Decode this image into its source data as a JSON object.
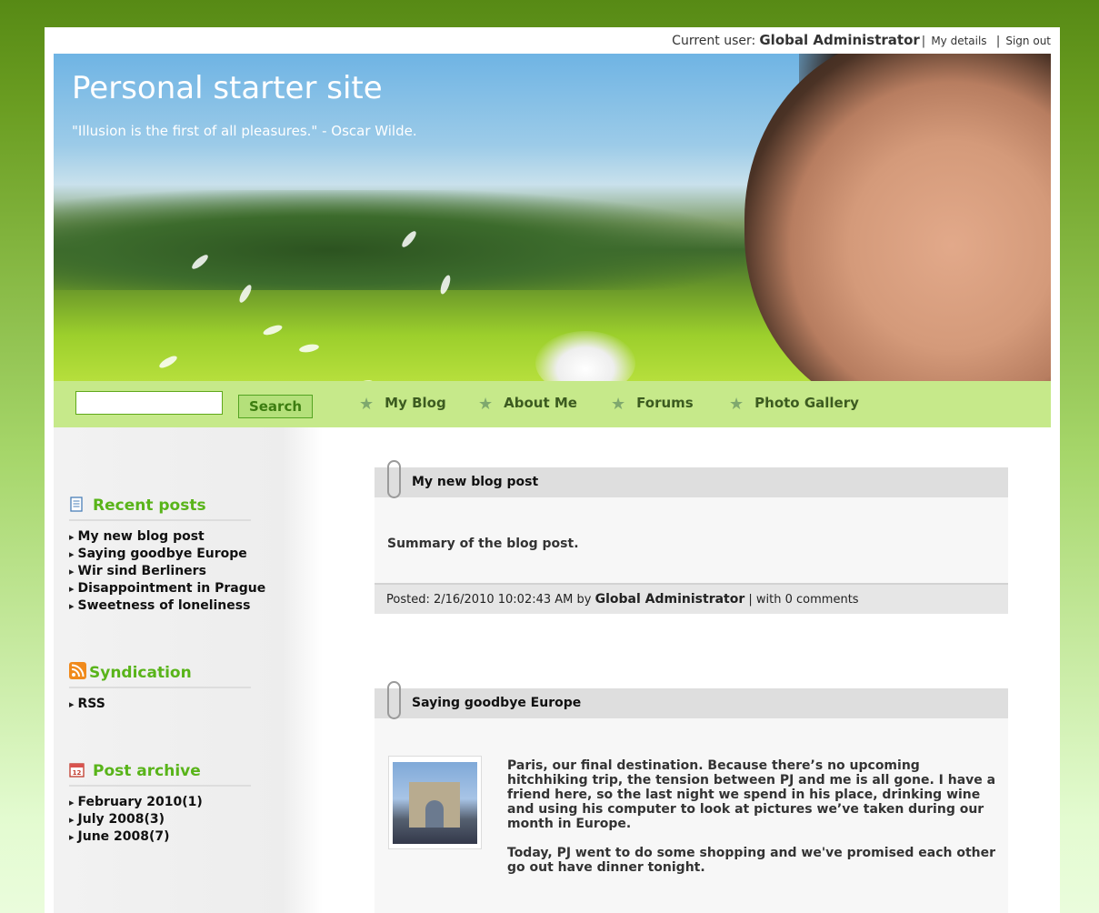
{
  "topbar": {
    "current_user_label": "Current user:",
    "user_name": "Global Administrator",
    "my_details": "My details",
    "sign_out": "Sign out"
  },
  "header": {
    "title": "Personal starter site",
    "quote": "\"Illusion is the first of all pleasures.\" - Oscar Wilde."
  },
  "search": {
    "value": "",
    "button_label": "Search"
  },
  "nav": {
    "items": [
      {
        "label": "My Blog",
        "icon": "star-icon"
      },
      {
        "label": "About Me",
        "icon": "star-icon"
      },
      {
        "label": "Forums",
        "icon": "star-icon"
      },
      {
        "label": "Photo Gallery",
        "icon": "star-icon"
      }
    ]
  },
  "sidebar": {
    "recent_posts": {
      "title": "Recent posts",
      "icon": "document-icon",
      "items": [
        "My new blog post",
        "Saying goodbye Europe",
        "Wir sind Berliners",
        "Disappointment in Prague",
        "Sweetness of loneliness"
      ]
    },
    "syndication": {
      "title": "Syndication",
      "icon": "rss-icon",
      "items": [
        "RSS"
      ]
    },
    "archive": {
      "title": "Post archive",
      "icon": "calendar-icon",
      "items": [
        "February 2010(1)",
        "July 2008(3)",
        "June 2008(7)"
      ]
    }
  },
  "posts": [
    {
      "title": "My new blog post",
      "summary": "Summary of the blog post.",
      "footer_prefix": "Posted: 2/16/2010 10:02:43 AM by",
      "author": "Global Administrator",
      "footer_suffix": "| with 0 comments"
    },
    {
      "title": "Saying goodbye Europe",
      "paragraph1": "Paris, our final destination. Because there’s no upcoming hitchhiking trip, the tension between PJ and me is all gone. I have a friend here, so the last night we spend in his place, drinking wine and using his computer to look at pictures we’ve taken during our month in Europe.",
      "paragraph2": "Today, PJ went to do some shopping and we've promised each other go out have dinner tonight."
    }
  ],
  "colors": {
    "accent_green": "#59b41a",
    "nav_bg": "#c6e98a",
    "frame_green": "#578a15"
  }
}
